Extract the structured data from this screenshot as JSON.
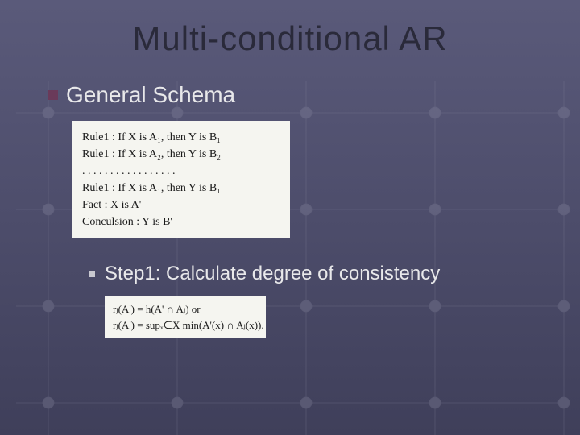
{
  "title": "Multi-conditional AR",
  "section": "General Schema",
  "schema_box": {
    "rule1": "Rule1 : If X is A₁, then Y is B₁",
    "rule2": "Rule1 : If X is A₂, then Y is B₂",
    "dots": ". . . . . . . . . . . . . . . . .",
    "rule_n": "Rule1 : If X is A₁, then Y is B₁",
    "fact": "Fact :   X is A'",
    "conclusion": "Conculsion :  Y is B'"
  },
  "step": "Step1: Calculate degree of consistency",
  "step_box": {
    "line1": "rⱼ(A') = h(A' ∩ Aⱼ)   or",
    "line2": "rⱼ(A') = supₓ∈X min(A'(x) ∩ Aⱼ(x))."
  }
}
